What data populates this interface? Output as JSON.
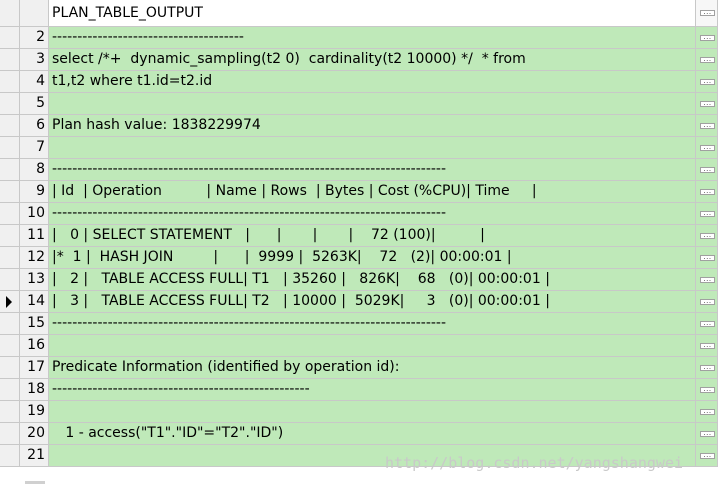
{
  "grid": {
    "header": "PLAN_TABLE_OUTPUT",
    "button_glyph": "...",
    "rows": [
      {
        "num": "2",
        "text": "--------------------------------------"
      },
      {
        "num": "3",
        "text": "select /*+  dynamic_sampling(t2 0)  cardinality(t2 10000) */  * from"
      },
      {
        "num": "4",
        "text": "t1,t2 where t1.id=t2.id"
      },
      {
        "num": "5",
        "text": ""
      },
      {
        "num": "6",
        "text": "Plan hash value: 1838229974"
      },
      {
        "num": "7",
        "text": ""
      },
      {
        "num": "8",
        "text": "------------------------------------------------------------------------------"
      },
      {
        "num": "9",
        "text": "| Id  | Operation          | Name | Rows  | Bytes | Cost (%CPU)| Time     |"
      },
      {
        "num": "10",
        "text": "------------------------------------------------------------------------------"
      },
      {
        "num": "11",
        "text": "|   0 | SELECT STATEMENT   |      |       |       |    72 (100)|          |"
      },
      {
        "num": "12",
        "text": "|*  1 |  HASH JOIN         |      |  9999 |  5263K|    72   (2)| 00:00:01 |"
      },
      {
        "num": "13",
        "text": "|   2 |   TABLE ACCESS FULL| T1   | 35260 |   826K|    68   (0)| 00:00:01 |"
      },
      {
        "num": "14",
        "text": "|   3 |   TABLE ACCESS FULL| T2   | 10000 |  5029K|     3   (0)| 00:00:01 |",
        "current": true
      },
      {
        "num": "15",
        "text": "------------------------------------------------------------------------------"
      },
      {
        "num": "16",
        "text": ""
      },
      {
        "num": "17",
        "text": "Predicate Information (identified by operation id):"
      },
      {
        "num": "18",
        "text": "---------------------------------------------------"
      },
      {
        "num": "19",
        "text": ""
      },
      {
        "num": "20",
        "text": "   1 - access(\"T1\".\"ID\"=\"T2\".\"ID\")"
      },
      {
        "num": "21",
        "text": ""
      }
    ]
  },
  "watermark": "http://blog.csdn.net/yangshangwei"
}
